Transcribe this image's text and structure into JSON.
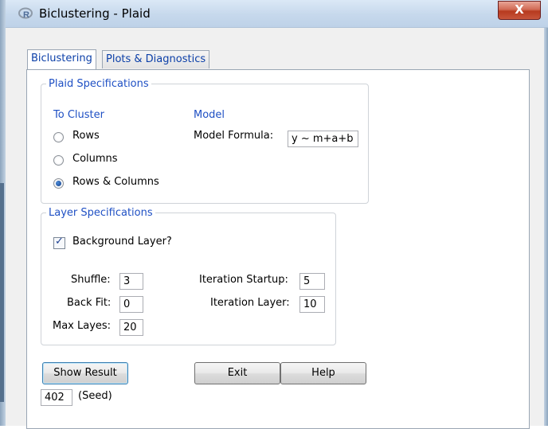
{
  "window": {
    "title": "Biclustering - Plaid",
    "close_symbol": "X",
    "app_icon": "r-logo-icon"
  },
  "tabs": [
    {
      "label": "Biclustering",
      "active": true
    },
    {
      "label": "Plots & Diagnostics",
      "active": false
    }
  ],
  "plaid_specs": {
    "legend": "Plaid Specifications",
    "to_cluster_heading": "To Cluster",
    "options": [
      "Rows",
      "Columns",
      "Rows & Columns"
    ],
    "selected": "Rows & Columns",
    "model_heading": "Model",
    "model_formula_label": "Model Formula:",
    "model_formula_value": "y ~ m+a+b"
  },
  "layer_specs": {
    "legend": "Layer Specifications",
    "background_layer_label": "Background Layer?",
    "background_layer_checked": true,
    "shuffle_label": "Shuffle:",
    "shuffle_value": "3",
    "back_fit_label": "Back Fit:",
    "back_fit_value": "0",
    "max_layers_label": "Max Layes:",
    "max_layers_value": "20",
    "iteration_startup_label": "Iteration Startup:",
    "iteration_startup_value": "5",
    "iteration_layer_label": "Iteration Layer:",
    "iteration_layer_value": "10"
  },
  "buttons": {
    "show_result": "Show Result",
    "exit": "Exit",
    "help": "Help"
  },
  "seed": {
    "value": "402",
    "label": "(Seed)"
  },
  "colors": {
    "group_label": "#1f50c4",
    "tab_label": "#0b3fa8",
    "title_bar": "#c6d8ec",
    "close_button": "#c7553b"
  }
}
